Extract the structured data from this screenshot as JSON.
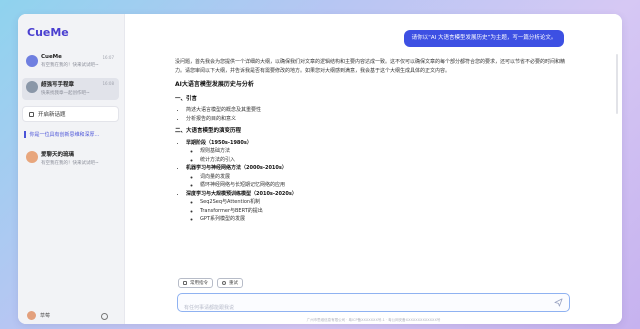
{
  "brand": {
    "name": "CueMe"
  },
  "sidebar": {
    "conversations": [
      {
        "title": "CueMe",
        "preview": "有空我在我的！快来试试吧~",
        "time": "16:07",
        "avatar_color": "#6f7fe0"
      },
      {
        "title": "超强写手程章",
        "preview": "快来找我章一起创作吧~",
        "time": "16:08",
        "avatar_color": "#8a97a8"
      }
    ],
    "new_chat_label": "开启新话题",
    "topic_label": "你是一位具有创新思维和深厚...",
    "pinned": {
      "title": "爱聊天的琉璃",
      "preview": "有空我在我的！快来试试吧~",
      "avatar_color": "#e8a67d"
    },
    "user_name": "草莓"
  },
  "chat": {
    "user_message": "请你以“AI 大语言模型发展历史”为主题，写一篇分析论文。",
    "intro": "没问题，首先我会为您提供一个详细的大纲，以确保我们对文章的逻辑结构和主要内容达成一致。这不仅可以确保文章的每个部分都符合您的要求，还可以节省不必要的时间和精力。请您审阅以下大纲，并告诉我是否有需要修改的地方。如果您对大纲感到满意，我会基于这个大纲生成具体的正文内容。",
    "outline_title": "AI大语言模型发展历史与分析",
    "section1": {
      "title": "一、引言",
      "items": [
        "简述大语言模型的概念及其重要性",
        "分析报告的目的和意义"
      ]
    },
    "section2": {
      "title": "二、大语言模型的演变历程",
      "stages": [
        {
          "title": "早期阶段（1950s-1980s）",
          "items": [
            "规则基础方法",
            "统计方法的引入"
          ]
        },
        {
          "title": "机器学习与神经网络方法（2000s-2010s）",
          "items": [
            "词向量的发展",
            "循环神经网络与长短期记忆网络的应用"
          ]
        },
        {
          "title": "深度学习与大规模预训练模型（2010s-2020s）",
          "items": [
            "Seq2Seq与Attention机制",
            "Transformer与BERT的提出",
            "GPT系列模型的发展"
          ]
        }
      ]
    }
  },
  "toolbar": {
    "prompt_label": "常用指令",
    "retry_label": "重试"
  },
  "input": {
    "placeholder": "有任何事请都能跟我说"
  },
  "footer": {
    "text": "广州市思维信息有限公司 · 粤ICP备XXXXXXX号-1 · 粤公网安备XXXXXXXXXXXXX号"
  }
}
